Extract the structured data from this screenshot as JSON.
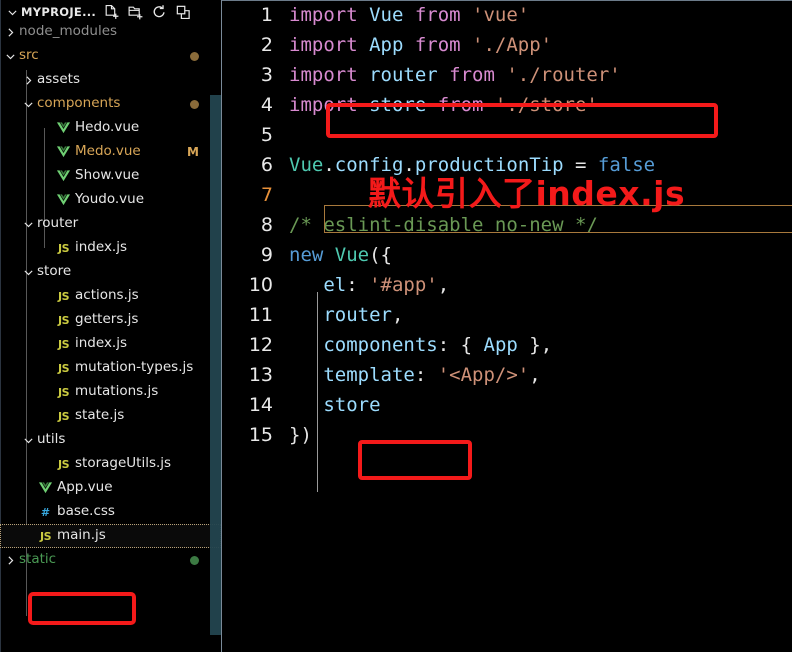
{
  "sidebar": {
    "title": "MYPROJE...",
    "collapse_chevron_icon": "chevron-down-icon",
    "actions": [
      {
        "name": "new-file-button",
        "icon": "new-file-icon",
        "label": "New File"
      },
      {
        "name": "new-folder-button",
        "icon": "new-folder-icon",
        "label": "New Folder"
      },
      {
        "name": "refresh-button",
        "icon": "refresh-icon",
        "label": "Refresh Explorer"
      },
      {
        "name": "collapse-all-button",
        "icon": "collapse-all-icon",
        "label": "Collapse Folders in Explorer"
      }
    ],
    "tree": [
      {
        "label": "node_modules",
        "type": "folder",
        "state": "collapsed",
        "depth": 1,
        "color": "dim"
      },
      {
        "label": "src",
        "type": "folder",
        "state": "expanded",
        "depth": 1,
        "color": "orange",
        "dot": "#8a6b3a"
      },
      {
        "label": "assets",
        "type": "folder",
        "state": "collapsed",
        "depth": 2,
        "color": "white"
      },
      {
        "label": "components",
        "type": "folder",
        "state": "expanded",
        "depth": 2,
        "color": "orange",
        "dot": "#8a6b3a"
      },
      {
        "label": "Hedo.vue",
        "type": "file",
        "icon": "vue-file-icon",
        "depth": 3,
        "color": "white"
      },
      {
        "label": "Medo.vue",
        "type": "file",
        "icon": "vue-file-icon",
        "depth": 3,
        "color": "orange",
        "badge": "M"
      },
      {
        "label": "Show.vue",
        "type": "file",
        "icon": "vue-file-icon",
        "depth": 3,
        "color": "white"
      },
      {
        "label": "Youdo.vue",
        "type": "file",
        "icon": "vue-file-icon",
        "depth": 3,
        "color": "white"
      },
      {
        "label": "router",
        "type": "folder",
        "state": "expanded",
        "depth": 2,
        "color": "white"
      },
      {
        "label": "index.js",
        "type": "file",
        "icon": "js-file-icon",
        "depth": 3,
        "color": "white"
      },
      {
        "label": "store",
        "type": "folder",
        "state": "expanded",
        "depth": 2,
        "color": "white"
      },
      {
        "label": "actions.js",
        "type": "file",
        "icon": "js-file-icon",
        "depth": 3,
        "color": "white"
      },
      {
        "label": "getters.js",
        "type": "file",
        "icon": "js-file-icon",
        "depth": 3,
        "color": "white"
      },
      {
        "label": "index.js",
        "type": "file",
        "icon": "js-file-icon",
        "depth": 3,
        "color": "white"
      },
      {
        "label": "mutation-types.js",
        "type": "file",
        "icon": "js-file-icon",
        "depth": 3,
        "color": "white"
      },
      {
        "label": "mutations.js",
        "type": "file",
        "icon": "js-file-icon",
        "depth": 3,
        "color": "white"
      },
      {
        "label": "state.js",
        "type": "file",
        "icon": "js-file-icon",
        "depth": 3,
        "color": "white"
      },
      {
        "label": "utils",
        "type": "folder",
        "state": "expanded",
        "depth": 2,
        "color": "white"
      },
      {
        "label": "storageUtils.js",
        "type": "file",
        "icon": "js-file-icon",
        "depth": 3,
        "color": "white"
      },
      {
        "label": "App.vue",
        "type": "file",
        "icon": "vue-file-icon",
        "depth": 2,
        "color": "white"
      },
      {
        "label": "base.css",
        "type": "file",
        "icon": "css-file-icon",
        "depth": 2,
        "color": "white"
      },
      {
        "label": "main.js",
        "type": "file",
        "icon": "js-file-icon",
        "depth": 2,
        "color": "white",
        "selected": true
      },
      {
        "label": "static",
        "type": "folder",
        "state": "collapsed",
        "depth": 1,
        "color": "green",
        "dot": "#3c7a43"
      }
    ]
  },
  "editor": {
    "language": "javascript",
    "active_line": 7,
    "lines": [
      {
        "n": "1",
        "tokens": [
          {
            "t": "import ",
            "c": "kw"
          },
          {
            "t": "Vue",
            "c": "id"
          },
          {
            "t": " from ",
            "c": "kw"
          },
          {
            "t": "'vue'",
            "c": "str"
          }
        ]
      },
      {
        "n": "2",
        "tokens": [
          {
            "t": "import ",
            "c": "kw"
          },
          {
            "t": "App",
            "c": "id"
          },
          {
            "t": " from ",
            "c": "kw"
          },
          {
            "t": "'./App'",
            "c": "str"
          }
        ]
      },
      {
        "n": "3",
        "tokens": [
          {
            "t": "import ",
            "c": "kw"
          },
          {
            "t": "router",
            "c": "id"
          },
          {
            "t": " from ",
            "c": "kw"
          },
          {
            "t": "'./router'",
            "c": "str"
          }
        ]
      },
      {
        "n": "4",
        "tokens": [
          {
            "t": "import ",
            "c": "kw"
          },
          {
            "t": "store",
            "c": "id"
          },
          {
            "t": " from ",
            "c": "kw"
          },
          {
            "t": "'./store'",
            "c": "str"
          }
        ]
      },
      {
        "n": "5",
        "tokens": []
      },
      {
        "n": "6",
        "tokens": [
          {
            "t": "Vue",
            "c": "cls"
          },
          {
            "t": ".",
            "c": "punc"
          },
          {
            "t": "config",
            "c": "prop"
          },
          {
            "t": ".",
            "c": "punc"
          },
          {
            "t": "productionTip",
            "c": "prop"
          },
          {
            "t": " = ",
            "c": "punc"
          },
          {
            "t": "false",
            "c": "new"
          }
        ]
      },
      {
        "n": "7",
        "tokens": []
      },
      {
        "n": "8",
        "tokens": [
          {
            "t": "/* eslint-disable no-new */",
            "c": "cmt"
          }
        ]
      },
      {
        "n": "9",
        "tokens": [
          {
            "t": "new",
            "c": "new"
          },
          {
            "t": " ",
            "c": "punc"
          },
          {
            "t": "Vue",
            "c": "cls"
          },
          {
            "t": "({",
            "c": "punc"
          }
        ]
      },
      {
        "n": "10",
        "tokens": [
          {
            "t": "   ",
            "c": "punc"
          },
          {
            "t": "el",
            "c": "prop"
          },
          {
            "t": ": ",
            "c": "punc"
          },
          {
            "t": "'#app'",
            "c": "str"
          },
          {
            "t": ",",
            "c": "punc"
          }
        ]
      },
      {
        "n": "11",
        "tokens": [
          {
            "t": "   ",
            "c": "punc"
          },
          {
            "t": "router",
            "c": "prop"
          },
          {
            "t": ",",
            "c": "punc"
          }
        ]
      },
      {
        "n": "12",
        "tokens": [
          {
            "t": "   ",
            "c": "punc"
          },
          {
            "t": "components",
            "c": "prop"
          },
          {
            "t": ": ",
            "c": "punc"
          },
          {
            "t": "{ ",
            "c": "punc"
          },
          {
            "t": "App",
            "c": "prop"
          },
          {
            "t": " },",
            "c": "punc"
          }
        ]
      },
      {
        "n": "13",
        "tokens": [
          {
            "t": "   ",
            "c": "punc"
          },
          {
            "t": "template",
            "c": "prop"
          },
          {
            "t": ": ",
            "c": "punc"
          },
          {
            "t": "'<App/>'",
            "c": "str"
          },
          {
            "t": ",",
            "c": "punc"
          }
        ]
      },
      {
        "n": "14",
        "tokens": [
          {
            "t": "   ",
            "c": "punc"
          },
          {
            "t": "store",
            "c": "prop"
          }
        ]
      },
      {
        "n": "15",
        "tokens": [
          {
            "t": "})",
            "c": "punc"
          }
        ]
      }
    ]
  },
  "annotations": {
    "color": "#f41a1a",
    "note_text": "默认引入了index.js",
    "highlighted_code_line": "import store from './store'",
    "highlighted_property": "store",
    "highlighted_file": "main.js"
  }
}
